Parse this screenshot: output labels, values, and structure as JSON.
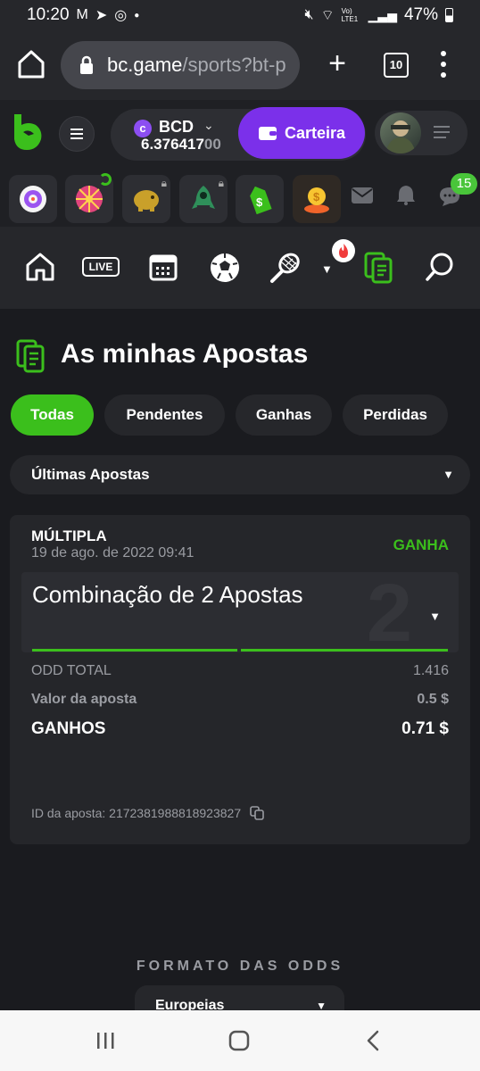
{
  "status": {
    "time": "10:20",
    "network": "Vo) LTE1",
    "battery": "47%"
  },
  "browser": {
    "url_host": "bc.game",
    "url_path": "/sports?bt-p",
    "tab_count": "10"
  },
  "header": {
    "currency": "BCD",
    "balance_main": "6.376417",
    "balance_dim": "00",
    "wallet_button": "Carteira"
  },
  "games_bar": {
    "chat_badge": "15"
  },
  "nav": {
    "live_label": "LIVE"
  },
  "page": {
    "title": "As minhas Apostas",
    "filters": [
      "Todas",
      "Pendentes",
      "Ganhas",
      "Perdidas"
    ],
    "select_label": "Últimas Apostas"
  },
  "bet": {
    "type": "MÚLTIPLA",
    "date": "19 de ago. de 2022 09:41",
    "status": "GANHA",
    "combo_label": "Combinação de 2 Apostas",
    "combo_count": "2",
    "odd_total_label": "ODD TOTAL",
    "odd_total": "1.416",
    "stake_label": "Valor da aposta",
    "stake": "0.5 $",
    "winnings_label": "GANHOS",
    "winnings": "0.71 $",
    "bet_id": "ID da aposta: 217238198881892382​7"
  },
  "odds_format": {
    "title": "FORMATO DAS ODDS",
    "value": "Europeias"
  },
  "colors": {
    "accent_green": "#3bbf1c",
    "wallet_purple": "#7b30ea"
  }
}
